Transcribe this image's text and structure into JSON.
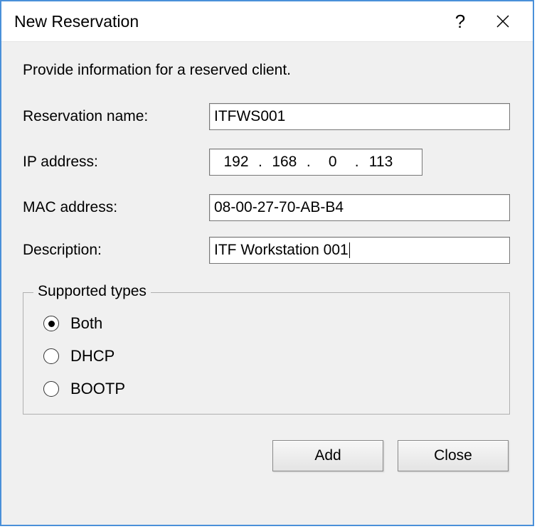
{
  "titlebar": {
    "title": "New Reservation"
  },
  "instruction": "Provide information for a reserved client.",
  "fields": {
    "reservation_name": {
      "label": "Reservation name:",
      "value": "ITFWS001"
    },
    "ip_address": {
      "label": "IP address:",
      "seg1": "192",
      "seg2": "168",
      "seg3": "0",
      "seg4": "113"
    },
    "mac_address": {
      "label": "MAC address:",
      "value": "08-00-27-70-AB-B4"
    },
    "description": {
      "label": "Description:",
      "value": "ITF Workstation 001"
    }
  },
  "supported_types": {
    "legend": "Supported types",
    "options": {
      "both": "Both",
      "dhcp": "DHCP",
      "bootp": "BOOTP"
    },
    "selected": "both"
  },
  "buttons": {
    "add": "Add",
    "close": "Close"
  }
}
